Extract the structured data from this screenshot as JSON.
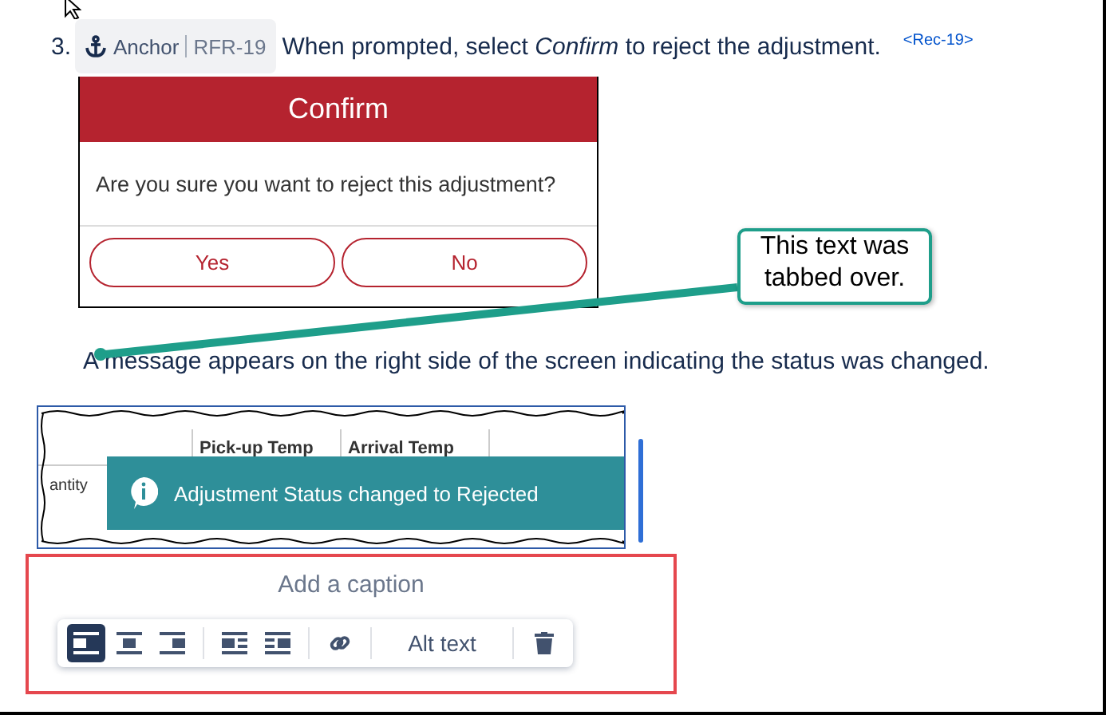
{
  "step": {
    "number": "3.",
    "anchor": {
      "label": "Anchor",
      "id": "RFR-19"
    },
    "text": "When prompted, select *Confirm* to reject the adjustment.",
    "ref": "<Rec-19>"
  },
  "dialog": {
    "title": "Confirm",
    "message": "Are you sure you want to reject this adjustment?",
    "buttons": [
      "Yes",
      "No"
    ]
  },
  "callout": {
    "text": "This text was tabbed over."
  },
  "paragraph": "A message appears on the right side of the screen indicating the status was changed.",
  "image": {
    "columns": [
      "Pick-up Temp",
      "Arrival Temp"
    ],
    "cell": "antity",
    "toast": "Adjustment Status changed to Rejected"
  },
  "caption": {
    "placeholder": "Add a caption",
    "toolbar": [
      {
        "kind": "align-left",
        "selected": true
      },
      {
        "kind": "align-center",
        "selected": false
      },
      {
        "kind": "align-right",
        "selected": false
      },
      {
        "kind": "separator"
      },
      {
        "kind": "wrap-left",
        "selected": false
      },
      {
        "kind": "wrap-right",
        "selected": false
      },
      {
        "kind": "separator"
      },
      {
        "kind": "link",
        "selected": false
      },
      {
        "kind": "separator"
      },
      {
        "kind": "text",
        "label": "Alt text",
        "selected": false
      },
      {
        "kind": "separator"
      },
      {
        "kind": "delete",
        "selected": false
      }
    ]
  }
}
